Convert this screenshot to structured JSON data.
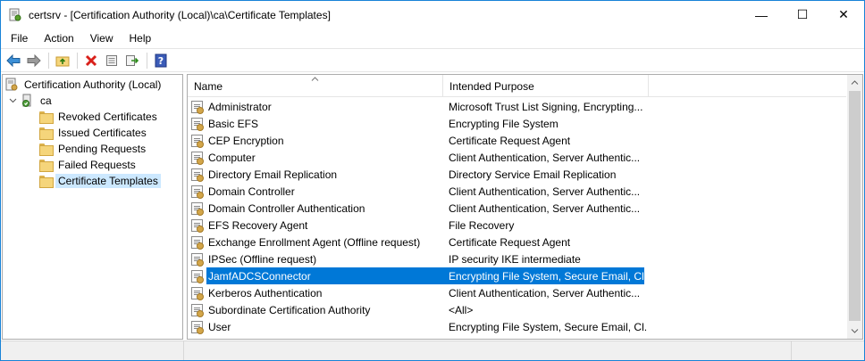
{
  "window": {
    "title": "certsrv - [Certification Authority (Local)\\ca\\Certificate Templates]",
    "controls": {
      "minimize": "—",
      "maximize": "☐",
      "close": "✕"
    }
  },
  "menu": {
    "items": [
      "File",
      "Action",
      "View",
      "Help"
    ]
  },
  "toolbar": {
    "buttons": [
      "back-icon",
      "forward-icon",
      "up-folder-icon",
      "delete-icon",
      "properties-icon",
      "export-icon",
      "help-icon"
    ]
  },
  "tree": {
    "root": "Certification Authority (Local)",
    "ca": "ca",
    "items": [
      "Revoked Certificates",
      "Issued Certificates",
      "Pending Requests",
      "Failed Requests",
      "Certificate Templates"
    ],
    "selected": "Certificate Templates"
  },
  "list": {
    "columns": {
      "name": "Name",
      "purpose": "Intended Purpose"
    },
    "rows": [
      {
        "name": "Administrator",
        "purpose": "Microsoft Trust List Signing, Encrypting..."
      },
      {
        "name": "Basic EFS",
        "purpose": "Encrypting File System"
      },
      {
        "name": "CEP Encryption",
        "purpose": "Certificate Request Agent"
      },
      {
        "name": "Computer",
        "purpose": "Client Authentication, Server Authentic..."
      },
      {
        "name": "Directory Email Replication",
        "purpose": "Directory Service Email Replication"
      },
      {
        "name": "Domain Controller",
        "purpose": "Client Authentication, Server Authentic..."
      },
      {
        "name": "Domain Controller Authentication",
        "purpose": "Client Authentication, Server Authentic..."
      },
      {
        "name": "EFS Recovery Agent",
        "purpose": "File Recovery"
      },
      {
        "name": "Exchange Enrollment Agent (Offline request)",
        "purpose": "Certificate Request Agent"
      },
      {
        "name": "IPSec (Offline request)",
        "purpose": "IP security IKE intermediate"
      },
      {
        "name": "JamfADCSConnector",
        "purpose": "Encrypting File System, Secure Email, Cl..."
      },
      {
        "name": "Kerberos Authentication",
        "purpose": "Client Authentication, Server Authentic..."
      },
      {
        "name": "Subordinate Certification Authority",
        "purpose": "<All>"
      },
      {
        "name": "User",
        "purpose": "Encrypting File System, Secure Email, Cl..."
      }
    ],
    "selected_row": "JamfADCSConnector"
  },
  "colors": {
    "selection": "#0078d7",
    "tree_selection": "#cce8ff",
    "window_border": "#1883d7"
  }
}
